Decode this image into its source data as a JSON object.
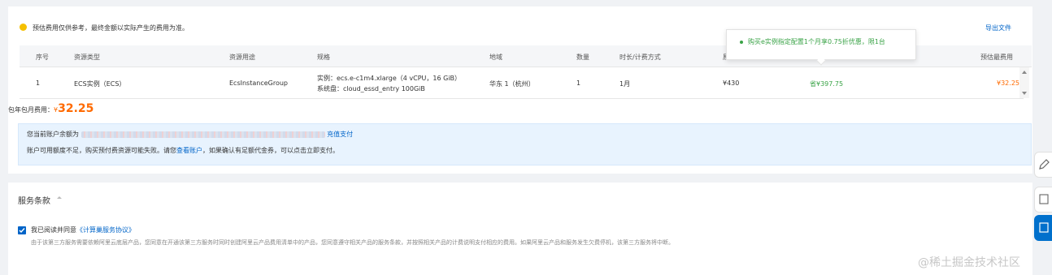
{
  "notice": {
    "text": "预估费用仅供参考，最终金额以实际产生的费用为准。",
    "export_link": "导出文件"
  },
  "table": {
    "headers": [
      "序号",
      "资源类型",
      "资源用途",
      "规格",
      "地域",
      "数量",
      "时长/计费方式",
      "原价",
      "",
      "预估最费用"
    ],
    "row": {
      "index": "1",
      "resource_type": "ECS实例（ECS）",
      "usage": "EcsInstanceGroup",
      "spec_line1": "实例：ecs.e-c1m4.xlarge（4 vCPU，16 GiB）",
      "spec_line2": "系统盘：cloud_essd_entry 100GiB",
      "region": "华东 1（杭州）",
      "quantity": "1",
      "duration": "1月",
      "price": "¥430",
      "saving": "省¥397.75",
      "estimated": "¥32.25"
    }
  },
  "tooltip": {
    "text": "购买e实例指定配置1个月享0.75折优惠，限1台"
  },
  "total": {
    "label": "包年包月费用：",
    "currency": "¥",
    "amount": "32.25"
  },
  "account": {
    "balance_label": "您当前账户余额为",
    "recharge_link": "充值支付",
    "warning_text": "账户可用额度不足，购买预付费资源可能失败。请您",
    "view_account_link": "查看账户",
    "warning_text_2": "，如果确认有足额代金券，可以点击立即支付。"
  },
  "terms": {
    "title": "服务条款",
    "agree_prefix": "我已阅读并同意",
    "agreement_link": "《计算巢服务协议》",
    "description": "由于该第三方服务需要依赖阿里云底层产品，您同意在开通该第三方服务时同时创建阿里云产品费用清单中的产品，您同意遵守相关产品的服务条款，并按照相关产品的计费说明支付相应的费用。如果阿里云产品和服务发生欠费停机，该第三方服务将中断。"
  },
  "watermark": "@稀土掘金技术社区",
  "colors": {
    "accent": "#0064c8",
    "price_orange": "#ff6a00",
    "saving_green": "#3aa347",
    "warning_yellow": "#f5c000"
  }
}
